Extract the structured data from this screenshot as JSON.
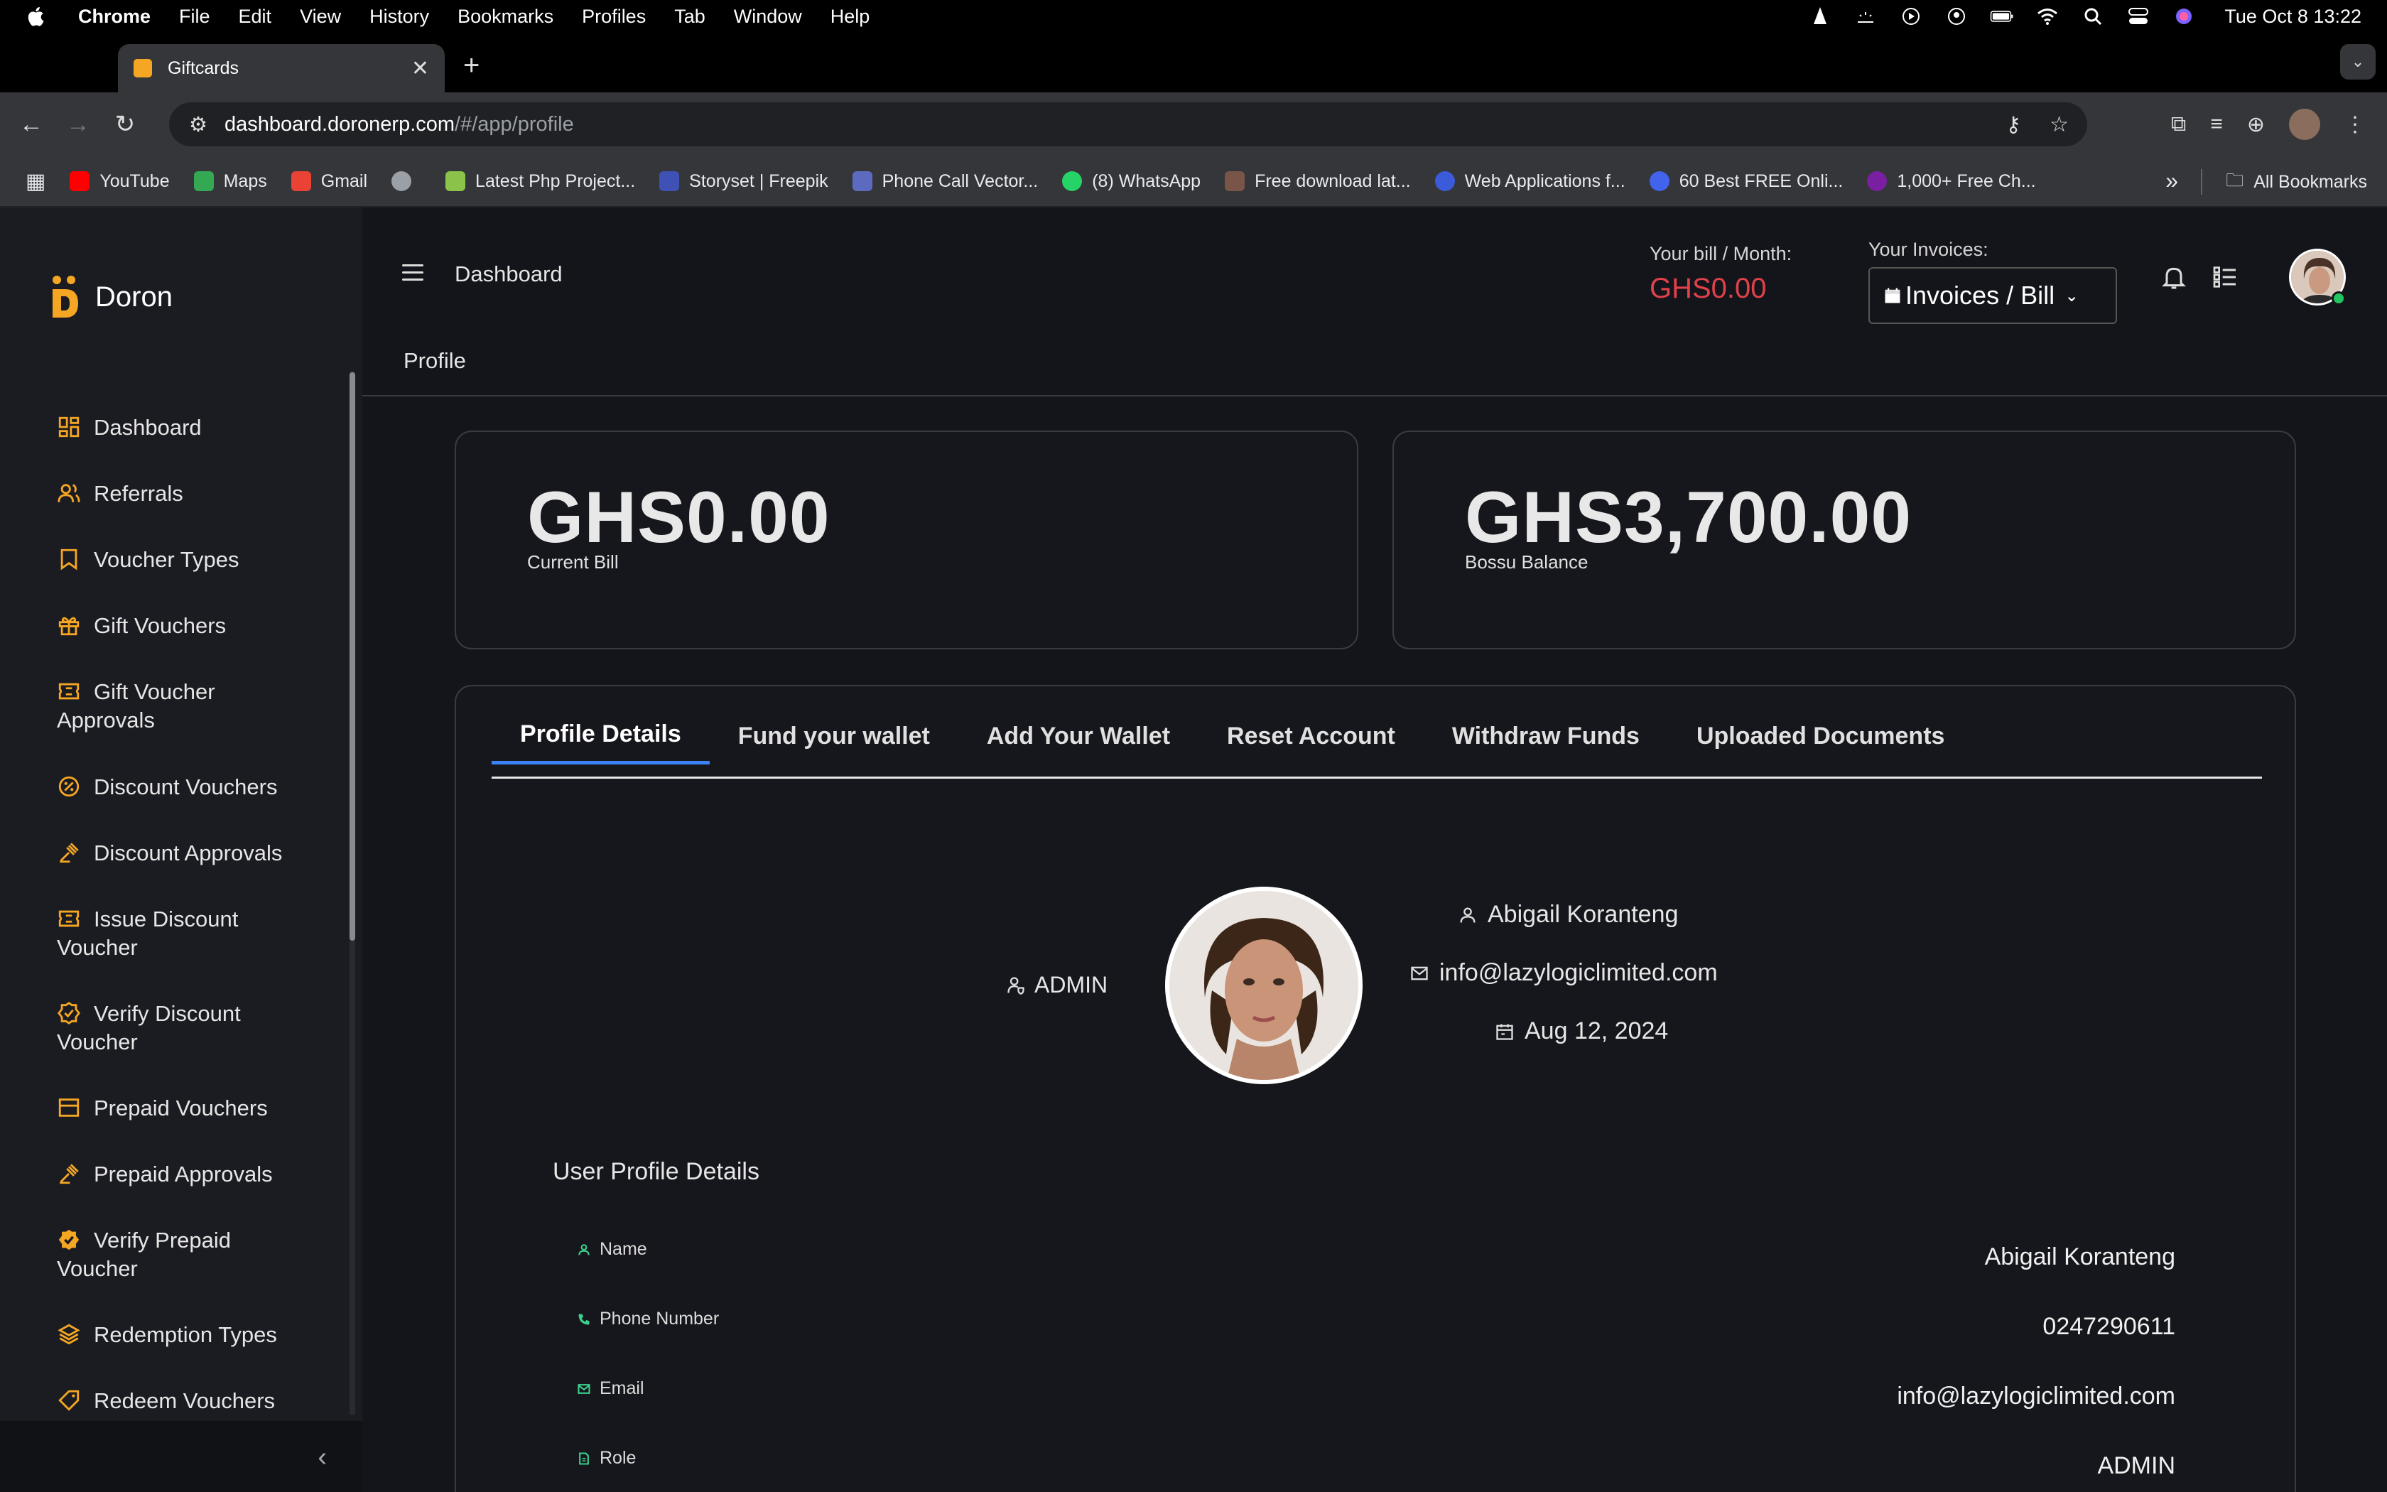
{
  "os_menubar": {
    "app_name": "Chrome",
    "menus": [
      "File",
      "Edit",
      "View",
      "History",
      "Bookmarks",
      "Profiles",
      "Tab",
      "Window",
      "Help"
    ],
    "clock": "Tue Oct 8  13:22"
  },
  "browser": {
    "tab_title": "Giftcards",
    "url_host": "dashboard.doronerp.com",
    "url_path": "/#/app/profile",
    "bookmarks": [
      {
        "label": "YouTube",
        "color": "#ff0000"
      },
      {
        "label": "Maps",
        "color": "#34a853"
      },
      {
        "label": "Gmail",
        "color": "#ea4335"
      },
      {
        "label": "",
        "color": "#9aa0a6"
      },
      {
        "label": "Latest Php Project...",
        "color": "#8bc34a"
      },
      {
        "label": "Storyset | Freepik",
        "color": "#3f51b5"
      },
      {
        "label": "Phone Call Vector...",
        "color": "#5c6bc0"
      },
      {
        "label": "(8) WhatsApp",
        "color": "#25d366"
      },
      {
        "label": "Free download lat...",
        "color": "#795548"
      },
      {
        "label": "Web Applications f...",
        "color": "#3b5bdb"
      },
      {
        "label": "60 Best FREE Onli...",
        "color": "#4263eb"
      },
      {
        "label": "1,000+ Free Ch...",
        "color": "#7b1fa2"
      }
    ],
    "all_bookmarks": "All Bookmarks"
  },
  "sidebar": {
    "brand": "Doron",
    "accent": "#f5a623",
    "items": [
      {
        "label": "Dashboard",
        "icon": "dashboard-icon"
      },
      {
        "label": "Referrals",
        "icon": "users-icon"
      },
      {
        "label": "Voucher Types",
        "icon": "bookmark-icon"
      },
      {
        "label": "Gift Vouchers",
        "icon": "gift-icon"
      },
      {
        "label": "Gift Voucher Approvals",
        "icon": "ticket-icon"
      },
      {
        "label": "Discount Vouchers",
        "icon": "discount-icon"
      },
      {
        "label": "Discount Approvals",
        "icon": "gavel-icon"
      },
      {
        "label": "Issue Discount Voucher",
        "icon": "ticket-icon"
      },
      {
        "label": "Verify Discount Voucher",
        "icon": "verified-icon"
      },
      {
        "label": "Prepaid Vouchers",
        "icon": "card-icon"
      },
      {
        "label": "Prepaid Approvals",
        "icon": "gavel-icon"
      },
      {
        "label": "Verify Prepaid Voucher",
        "icon": "verified-filled-icon"
      },
      {
        "label": "Redemption Types",
        "icon": "layers-icon"
      },
      {
        "label": "Redeem Vouchers",
        "icon": "tag-icon"
      }
    ]
  },
  "header": {
    "title": "Dashboard",
    "bill_label": "Your bill / Month:",
    "bill_value": "GHS0.00",
    "invoices_label": "Your Invoices:",
    "invoices_select": "Invoices / Bill",
    "breadcrumb": "Profile"
  },
  "cards": [
    {
      "value": "GHS0.00",
      "label": "Current Bill"
    },
    {
      "value": "GHS3,700.00",
      "label": "Bossu Balance"
    }
  ],
  "profile": {
    "tabs": [
      "Profile Details",
      "Fund your wallet",
      "Add Your Wallet",
      "Reset Account",
      "Withdraw Funds",
      "Uploaded Documents"
    ],
    "active_tab": "Profile Details",
    "role": "ADMIN",
    "name": "Abigail Koranteng",
    "email": "info@lazylogiclimited.com",
    "joined": "Aug 12, 2024",
    "section_title": "User Profile Details",
    "details": [
      {
        "label": "Name",
        "value": "Abigail Koranteng",
        "icon": "user-icon"
      },
      {
        "label": "Phone Number",
        "value": "0247290611",
        "icon": "phone-icon"
      },
      {
        "label": "Email",
        "value": "info@lazylogiclimited.com",
        "icon": "mail-icon"
      },
      {
        "label": "Role",
        "value": "ADMIN",
        "icon": "doc-icon"
      }
    ]
  }
}
